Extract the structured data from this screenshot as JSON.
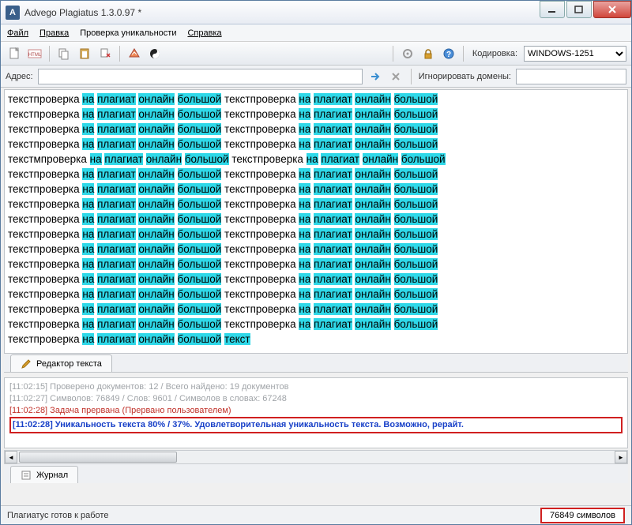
{
  "titlebar": {
    "app_initial": "A",
    "title": "Advego Plagiatus 1.3.0.97 *"
  },
  "menu": {
    "file": "Файл",
    "edit": "Правка",
    "check": "Проверка уникальности",
    "help": "Справка"
  },
  "toolbar": {
    "encoding_label": "Кодировка:",
    "encoding_value": "WINDOWS-1251"
  },
  "addrbar": {
    "addr_label": "Адрес:",
    "addr_value": "",
    "ignore_label": "Игнорировать домены:",
    "ignore_value": ""
  },
  "text": {
    "word_plain1": "текстпроверка ",
    "word_plain2": " текстпроверка ",
    "word_plain1b": "текстмпроверка ",
    "hl_na": "на",
    "hl_plag": "плагиат",
    "hl_onl": "онлайн",
    "hl_big": "большой",
    "hl_text": "текст",
    "sp": " "
  },
  "tabs": {
    "editor": "Редактор текста",
    "journal": "Журнал"
  },
  "log": {
    "l1": "[11:02:15] Проверено документов: 12  / Всего найдено: 19 документов",
    "l2": "[11:02:27] Символов: 76849 / Слов: 9601 / Символов в словах: 67248",
    "l3": "[11:02:28] Задача прервана (Прервано пользователем)",
    "l4": "[11:02:28] Уникальность текста 80% / 37%. Удовлетворительная уникальность текста. Возможно, рерайт."
  },
  "status": {
    "ready": "Плагиатус готов к работе",
    "symbols": "76849 символов"
  },
  "icons": {
    "new": "new-file-icon",
    "html": "html-icon",
    "copy": "copy-icon",
    "paste": "paste-icon",
    "clear": "clear-icon",
    "check": "check-icon",
    "yinyang": "yinyang-icon",
    "gear": "gear-icon",
    "lock": "lock-icon",
    "help": "help-icon",
    "go": "go-arrow-icon",
    "cancel": "cancel-icon"
  }
}
